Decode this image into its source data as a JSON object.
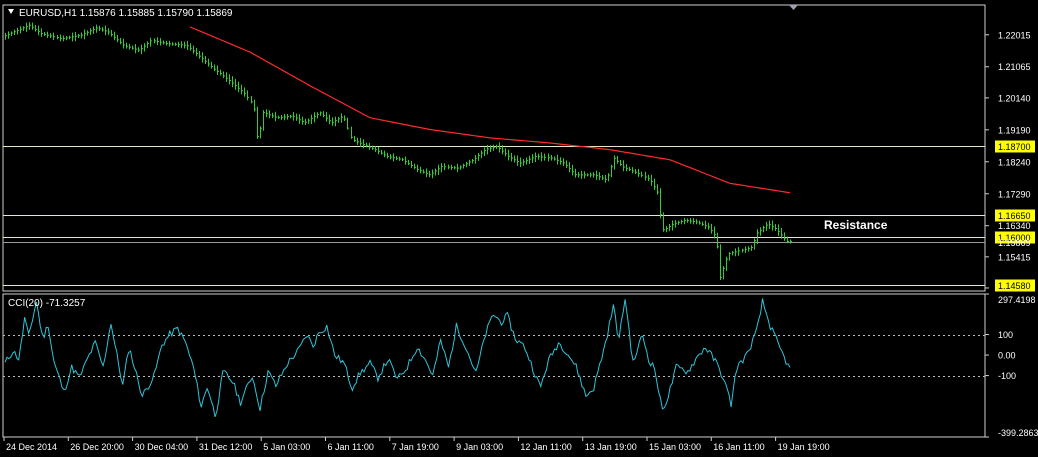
{
  "chart_data": [
    {
      "type": "bar",
      "title": "EURUSD,H1  1.15876 1.15885 1.15790 1.15869",
      "title_icon": "triangle-down-icon",
      "ylim": [
        1.144,
        1.229
      ],
      "y_ticks": [
        "1.22015",
        "1.21065",
        "1.20140",
        "1.19190",
        "1.18240",
        "1.17290",
        "1.16340",
        "1.15415",
        "1.14490"
      ],
      "hlines": [
        {
          "value": 1.187,
          "label": "1.18700"
        },
        {
          "value": 1.1665,
          "label": "1.16650"
        },
        {
          "value": 1.16,
          "label": "1.16000"
        },
        {
          "value": 1.1458,
          "label": "1.14580"
        }
      ],
      "extra_price_label": "1.15869",
      "annotation": "Resistance",
      "price_color": "#33cc33",
      "ma_color": "#ff2a2a",
      "price_keypoints": [
        [
          0,
          1.2195
        ],
        [
          0.02,
          1.2215
        ],
        [
          0.035,
          1.223
        ],
        [
          0.05,
          1.2205
        ],
        [
          0.075,
          1.219
        ],
        [
          0.1,
          1.22
        ],
        [
          0.12,
          1.2222
        ],
        [
          0.135,
          1.221
        ],
        [
          0.155,
          1.217
        ],
        [
          0.175,
          1.2155
        ],
        [
          0.19,
          1.2185
        ],
        [
          0.21,
          1.2175
        ],
        [
          0.235,
          1.217
        ],
        [
          0.255,
          1.213
        ],
        [
          0.27,
          1.21
        ],
        [
          0.29,
          1.2065
        ],
        [
          0.31,
          1.2025
        ],
        [
          0.32,
          1.199
        ],
        [
          0.325,
          1.1885
        ],
        [
          0.332,
          1.197
        ],
        [
          0.35,
          1.1955
        ],
        [
          0.37,
          1.196
        ],
        [
          0.385,
          1.194
        ],
        [
          0.405,
          1.197
        ],
        [
          0.42,
          1.194
        ],
        [
          0.435,
          1.196
        ],
        [
          0.445,
          1.189
        ],
        [
          0.46,
          1.1875
        ],
        [
          0.475,
          1.186
        ],
        [
          0.49,
          1.184
        ],
        [
          0.51,
          1.183
        ],
        [
          0.53,
          1.18
        ],
        [
          0.545,
          1.1785
        ],
        [
          0.56,
          1.181
        ],
        [
          0.58,
          1.1805
        ],
        [
          0.6,
          1.183
        ],
        [
          0.615,
          1.186
        ],
        [
          0.63,
          1.187
        ],
        [
          0.645,
          1.184
        ],
        [
          0.66,
          1.182
        ],
        [
          0.68,
          1.184
        ],
        [
          0.7,
          1.1835
        ],
        [
          0.715,
          1.182
        ],
        [
          0.73,
          1.1785
        ],
        [
          0.755,
          1.1785
        ],
        [
          0.77,
          1.177
        ],
        [
          0.78,
          1.1835
        ],
        [
          0.79,
          1.181
        ],
        [
          0.81,
          1.179
        ],
        [
          0.825,
          1.177
        ],
        [
          0.835,
          1.173
        ],
        [
          0.84,
          1.162
        ],
        [
          0.845,
          1.1625
        ],
        [
          0.855,
          1.164
        ],
        [
          0.87,
          1.165
        ],
        [
          0.885,
          1.1645
        ],
        [
          0.9,
          1.163
        ],
        [
          0.91,
          1.16
        ],
        [
          0.915,
          1.148
        ],
        [
          0.925,
          1.155
        ],
        [
          0.94,
          1.156
        ],
        [
          0.955,
          1.157
        ],
        [
          0.96,
          1.161
        ],
        [
          0.975,
          1.164
        ],
        [
          0.985,
          1.1625
        ],
        [
          1.0,
          1.1587
        ]
      ],
      "ma_keypoints": [
        [
          0.0,
          1.2225
        ],
        [
          0.1,
          1.215
        ],
        [
          0.2,
          1.205
        ],
        [
          0.3,
          1.1955
        ],
        [
          0.4,
          1.192
        ],
        [
          0.5,
          1.1895
        ],
        [
          0.6,
          1.188
        ],
        [
          0.7,
          1.186
        ],
        [
          0.8,
          1.183
        ],
        [
          0.9,
          1.176
        ],
        [
          1.0,
          1.1732
        ]
      ]
    },
    {
      "type": "line",
      "title": "CCI(20) -71.3257",
      "ylim": [
        -399.2863,
        297.4198
      ],
      "y_ticks": [
        "297.4198",
        "100",
        "0.00",
        "-100",
        "-399.2863"
      ],
      "levels": [
        100,
        -100
      ],
      "line_color": "#2ec4d8",
      "cci_keypoints": [
        [
          0.0,
          -40
        ],
        [
          0.01,
          20
        ],
        [
          0.018,
          -20
        ],
        [
          0.025,
          180
        ],
        [
          0.03,
          90
        ],
        [
          0.04,
          260
        ],
        [
          0.048,
          80
        ],
        [
          0.055,
          150
        ],
        [
          0.062,
          -30
        ],
        [
          0.075,
          -180
        ],
        [
          0.085,
          -60
        ],
        [
          0.095,
          -110
        ],
        [
          0.105,
          -20
        ],
        [
          0.115,
          60
        ],
        [
          0.125,
          -60
        ],
        [
          0.135,
          160
        ],
        [
          0.14,
          50
        ],
        [
          0.15,
          -150
        ],
        [
          0.158,
          40
        ],
        [
          0.165,
          -60
        ],
        [
          0.175,
          -200
        ],
        [
          0.19,
          -100
        ],
        [
          0.2,
          50
        ],
        [
          0.21,
          100
        ],
        [
          0.22,
          130
        ],
        [
          0.23,
          60
        ],
        [
          0.24,
          -60
        ],
        [
          0.25,
          -250
        ],
        [
          0.258,
          -150
        ],
        [
          0.268,
          -300
        ],
        [
          0.278,
          -80
        ],
        [
          0.29,
          -130
        ],
        [
          0.3,
          -230
        ],
        [
          0.315,
          -100
        ],
        [
          0.325,
          -260
        ],
        [
          0.335,
          -80
        ],
        [
          0.345,
          -150
        ],
        [
          0.36,
          -40
        ],
        [
          0.375,
          30
        ],
        [
          0.385,
          100
        ],
        [
          0.392,
          40
        ],
        [
          0.4,
          110
        ],
        [
          0.41,
          140
        ],
        [
          0.42,
          0
        ],
        [
          0.432,
          -40
        ],
        [
          0.442,
          -160
        ],
        [
          0.452,
          -90
        ],
        [
          0.465,
          -40
        ],
        [
          0.475,
          -110
        ],
        [
          0.488,
          -20
        ],
        [
          0.5,
          -120
        ],
        [
          0.512,
          -60
        ],
        [
          0.525,
          40
        ],
        [
          0.535,
          -20
        ],
        [
          0.545,
          -100
        ],
        [
          0.555,
          70
        ],
        [
          0.565,
          -60
        ],
        [
          0.575,
          140
        ],
        [
          0.585,
          60
        ],
        [
          0.6,
          -90
        ],
        [
          0.612,
          100
        ],
        [
          0.622,
          200
        ],
        [
          0.632,
          160
        ],
        [
          0.64,
          190
        ],
        [
          0.65,
          80
        ],
        [
          0.662,
          40
        ],
        [
          0.672,
          -60
        ],
        [
          0.682,
          -160
        ],
        [
          0.692,
          -30
        ],
        [
          0.705,
          60
        ],
        [
          0.715,
          20
        ],
        [
          0.728,
          -60
        ],
        [
          0.74,
          -200
        ],
        [
          0.75,
          -160
        ],
        [
          0.765,
          60
        ],
        [
          0.775,
          240
        ],
        [
          0.782,
          70
        ],
        [
          0.79,
          280
        ],
        [
          0.8,
          -40
        ],
        [
          0.812,
          100
        ],
        [
          0.82,
          -20
        ],
        [
          0.828,
          -70
        ],
        [
          0.837,
          -270
        ],
        [
          0.845,
          -200
        ],
        [
          0.855,
          -60
        ],
        [
          0.87,
          -80
        ],
        [
          0.88,
          -20
        ],
        [
          0.892,
          40
        ],
        [
          0.905,
          -30
        ],
        [
          0.915,
          -110
        ],
        [
          0.925,
          -240
        ],
        [
          0.932,
          -60
        ],
        [
          0.945,
          0
        ],
        [
          0.958,
          120
        ],
        [
          0.965,
          260
        ],
        [
          0.975,
          140
        ],
        [
          0.985,
          50
        ],
        [
          1.0,
          -71.3
        ]
      ]
    }
  ],
  "x_axis": {
    "labels": [
      "24 Dec 2014",
      "26 Dec 20:00",
      "30 Dec 04:00",
      "31 Dec 12:00",
      "5 Jan 03:00",
      "6 Jan 11:00",
      "7 Jan 19:00",
      "9 Jan 03:00",
      "12 Jan 11:00",
      "13 Jan 19:00",
      "15 Jan 03:00",
      "16 Jan 11:00",
      "19 Jan 19:00"
    ]
  }
}
